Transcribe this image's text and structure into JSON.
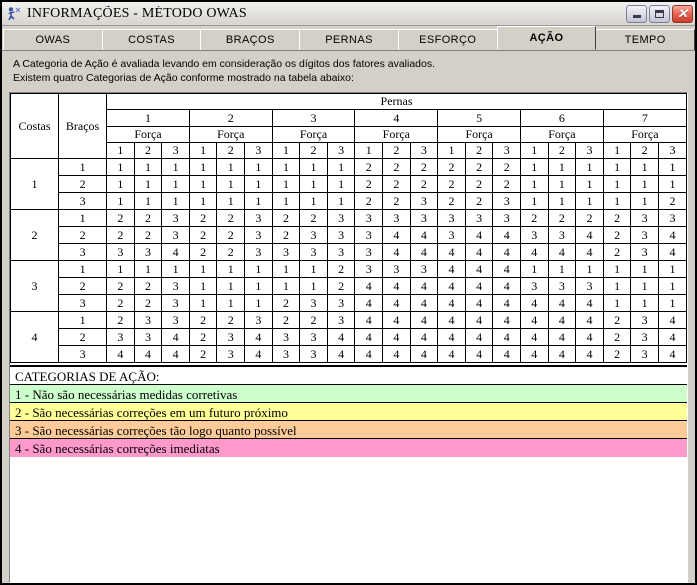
{
  "window": {
    "title": "INFORMAÇÕES - MÉTODO OWAS",
    "icon": "app-owas-icon",
    "buttons": {
      "minimize": "minimize-icon",
      "maximize": "maximize-icon",
      "close": "close-icon"
    }
  },
  "tabs": [
    {
      "label": "OWAS",
      "active": false
    },
    {
      "label": "COSTAS",
      "active": false
    },
    {
      "label": "BRAÇOS",
      "active": false
    },
    {
      "label": "PERNAS",
      "active": false
    },
    {
      "label": "ESFORÇO",
      "active": false
    },
    {
      "label": "AÇÃO",
      "active": true
    },
    {
      "label": "TEMPO",
      "active": false
    }
  ],
  "intro": {
    "line1": "A Categoria de Ação é avaliada levando em consideração os dígitos dos fatores avaliados.",
    "line2": "Existem quatro Categorias de Ação conforme mostrado na tabela abaixo:"
  },
  "table": {
    "col_headers": {
      "costas": "Costas",
      "bracos": "Braços",
      "pernas": "Pernas",
      "forca": "Força"
    },
    "legs": [
      "1",
      "2",
      "3",
      "4",
      "5",
      "6",
      "7"
    ],
    "force_levels": [
      "1",
      "2",
      "3"
    ],
    "back_levels": [
      "1",
      "2",
      "3",
      "4"
    ],
    "arm_levels": [
      "1",
      "2",
      "3"
    ],
    "rows": [
      {
        "costas": "1",
        "bracos": "1",
        "values": [
          1,
          1,
          1,
          1,
          1,
          1,
          1,
          1,
          1,
          2,
          2,
          2,
          2,
          2,
          2,
          1,
          1,
          1,
          1,
          1,
          1
        ]
      },
      {
        "costas": "1",
        "bracos": "2",
        "values": [
          1,
          1,
          1,
          1,
          1,
          1,
          1,
          1,
          1,
          2,
          2,
          2,
          2,
          2,
          2,
          1,
          1,
          1,
          1,
          1,
          1
        ]
      },
      {
        "costas": "1",
        "bracos": "3",
        "values": [
          1,
          1,
          1,
          1,
          1,
          1,
          1,
          1,
          1,
          2,
          2,
          3,
          2,
          2,
          3,
          1,
          1,
          1,
          1,
          1,
          2
        ]
      },
      {
        "costas": "2",
        "bracos": "1",
        "values": [
          2,
          2,
          3,
          2,
          2,
          3,
          2,
          2,
          3,
          3,
          3,
          3,
          3,
          3,
          3,
          2,
          2,
          2,
          2,
          3,
          3
        ]
      },
      {
        "costas": "2",
        "bracos": "2",
        "values": [
          2,
          2,
          3,
          2,
          2,
          3,
          2,
          3,
          3,
          3,
          4,
          4,
          3,
          4,
          4,
          3,
          3,
          4,
          2,
          3,
          4
        ]
      },
      {
        "costas": "2",
        "bracos": "3",
        "values": [
          3,
          3,
          4,
          2,
          2,
          3,
          3,
          3,
          3,
          3,
          4,
          4,
          4,
          4,
          4,
          4,
          4,
          4,
          2,
          3,
          4
        ]
      },
      {
        "costas": "3",
        "bracos": "1",
        "values": [
          1,
          1,
          1,
          1,
          1,
          1,
          1,
          1,
          2,
          3,
          3,
          3,
          4,
          4,
          4,
          1,
          1,
          1,
          1,
          1,
          1
        ]
      },
      {
        "costas": "3",
        "bracos": "2",
        "values": [
          2,
          2,
          3,
          1,
          1,
          1,
          1,
          1,
          2,
          4,
          4,
          4,
          4,
          4,
          4,
          3,
          3,
          3,
          1,
          1,
          1
        ]
      },
      {
        "costas": "3",
        "bracos": "3",
        "values": [
          2,
          2,
          3,
          1,
          1,
          1,
          2,
          3,
          3,
          4,
          4,
          4,
          4,
          4,
          4,
          4,
          4,
          4,
          1,
          1,
          1
        ]
      },
      {
        "costas": "4",
        "bracos": "1",
        "values": [
          2,
          3,
          3,
          2,
          2,
          3,
          2,
          2,
          3,
          4,
          4,
          4,
          4,
          4,
          4,
          4,
          4,
          4,
          2,
          3,
          4
        ]
      },
      {
        "costas": "4",
        "bracos": "2",
        "values": [
          3,
          3,
          4,
          2,
          3,
          4,
          3,
          3,
          4,
          4,
          4,
          4,
          4,
          4,
          4,
          4,
          4,
          4,
          2,
          3,
          4
        ]
      },
      {
        "costas": "4",
        "bracos": "3",
        "values": [
          4,
          4,
          4,
          2,
          3,
          4,
          3,
          3,
          4,
          4,
          4,
          4,
          4,
          4,
          4,
          4,
          4,
          4,
          2,
          3,
          4
        ]
      }
    ]
  },
  "legend": {
    "title": "CATEGORIAS DE AÇÃO:",
    "items": [
      {
        "text": "1 - Não são necessárias medidas corretivas",
        "color": "#ccffcc"
      },
      {
        "text": "2 - São necessárias correções em um futuro próximo",
        "color": "#ffff99"
      },
      {
        "text": "3 - São necessárias correções tão logo quanto possível",
        "color": "#ffcc99"
      },
      {
        "text": "4 - São necessárias correções imediatas",
        "color": "#ff99cc"
      }
    ]
  },
  "colors": {
    "cat1": "#ccffcc",
    "cat2": "#ffff99",
    "cat3": "#ffcc99",
    "cat4": "#ff99cc",
    "window_face": "#d4d0c8"
  }
}
